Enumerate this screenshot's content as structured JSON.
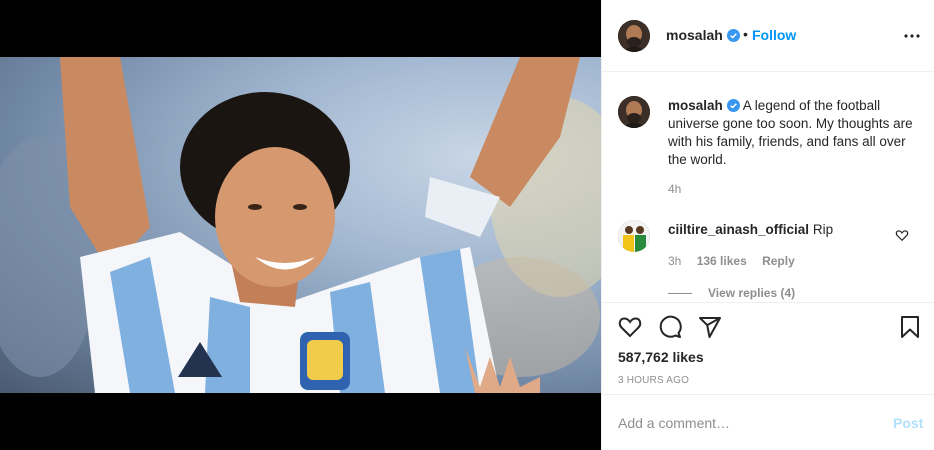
{
  "post": {
    "username": "mosalah",
    "follow_label": "Follow",
    "dot": "•",
    "caption": "A legend of the football universe gone too soon. My thoughts are with his family, friends, and fans all over the world.",
    "caption_time": "4h",
    "likes": "587,762 likes",
    "posted_ago": "3 HOURS AGO"
  },
  "reply": {
    "username": "ciiltire_ainash_official",
    "text": "Rip",
    "time": "3h",
    "likes": "136 likes",
    "reply_label": "Reply",
    "view_replies": "View replies (4)"
  },
  "composer": {
    "placeholder": "Add a comment…",
    "post_label": "Post"
  },
  "icons": {
    "verified": "verified-badge-icon",
    "more": "more-options-icon",
    "like": "heart-icon",
    "comment": "comment-icon",
    "share": "share-icon",
    "save": "bookmark-icon"
  },
  "colors": {
    "link": "#0095f6",
    "muted": "#8e8e8e",
    "post_disabled": "#b2dffc",
    "verified": "#3897f0"
  }
}
